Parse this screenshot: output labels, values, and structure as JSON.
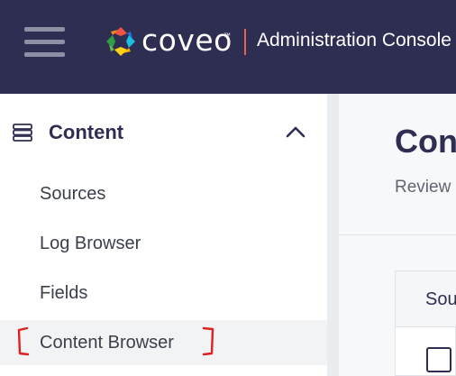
{
  "header": {
    "brand_name": "coveo",
    "brand_tm": "™",
    "title": "Administration Console"
  },
  "sidebar": {
    "section": {
      "label": "Content",
      "icon": "storage-icon",
      "expanded": true
    },
    "items": [
      {
        "label": "Sources"
      },
      {
        "label": "Log Browser"
      },
      {
        "label": "Fields"
      },
      {
        "label": "Content Browser",
        "active": true
      }
    ]
  },
  "main": {
    "title": "Con",
    "subtitle": "Review",
    "card": {
      "header_label": "Sou"
    }
  },
  "colors": {
    "header_bg": "#2e2e52",
    "accent_divider": "#e8635a",
    "highlight_bracket": "#e02020",
    "active_item_bg": "#f1f3f5"
  }
}
